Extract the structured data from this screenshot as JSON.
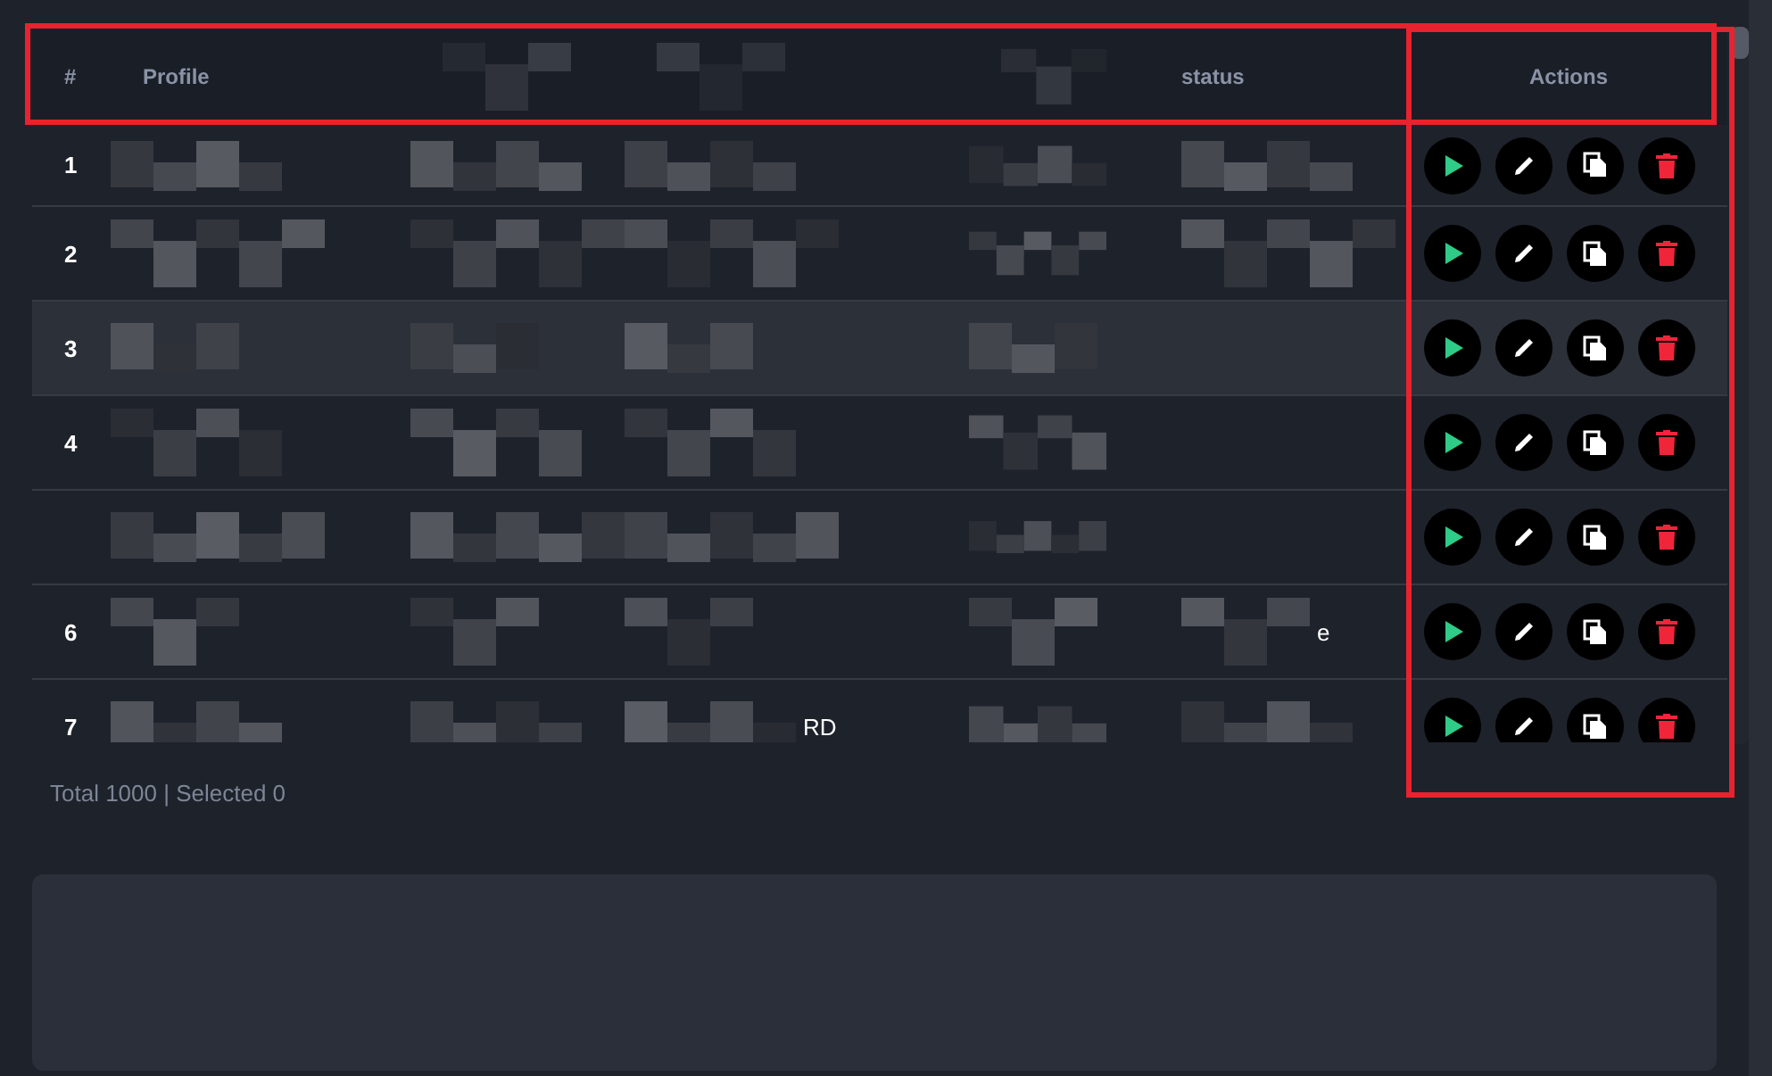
{
  "table": {
    "header_outlined": true,
    "columns": [
      {
        "label": "#",
        "outlined": false
      },
      {
        "label": "Profile",
        "outlined": false
      },
      {
        "redacted": true,
        "outlined": false
      },
      {
        "redacted": true,
        "outlined": false
      },
      {
        "redacted": true,
        "outlined": false
      },
      {
        "label": "status",
        "outlined": false
      },
      {
        "label": "Actions",
        "kind": "actions",
        "outlined": true
      }
    ],
    "rows": [
      {
        "number": "1",
        "highlighted": false,
        "cells": [
          {
            "redacted": true
          },
          {
            "redacted": true
          },
          {
            "redacted": true
          },
          {
            "redacted": true
          },
          {
            "redacted": true
          }
        ]
      },
      {
        "number": "2",
        "highlighted": false,
        "cells": [
          {
            "redacted": true
          },
          {
            "redacted": true
          },
          {
            "redacted": true
          },
          {
            "redacted": true
          },
          {
            "redacted": true
          }
        ]
      },
      {
        "number": "3",
        "highlighted": true,
        "cells": [
          {
            "redacted": true
          },
          {
            "redacted": true
          },
          {
            "redacted": true
          },
          {
            "redacted": true
          },
          {
            "redacted": false
          }
        ]
      },
      {
        "number": "4",
        "highlighted": false,
        "cells": [
          {
            "redacted": true
          },
          {
            "redacted": true
          },
          {
            "redacted": true
          },
          {
            "redacted": true
          },
          {
            "redacted": false
          }
        ]
      },
      {
        "highlighted": false,
        "cells": [
          {
            "redacted": true
          },
          {
            "redacted": true
          },
          {
            "redacted": true
          },
          {
            "redacted": true
          },
          {
            "redacted": false
          }
        ]
      },
      {
        "number": "6",
        "highlighted": false,
        "cells": [
          {
            "redacted": true
          },
          {
            "redacted": true
          },
          {
            "redacted": true
          },
          {
            "redacted": true
          },
          {
            "redacted": true,
            "text": "e"
          }
        ]
      },
      {
        "number": "7",
        "highlighted": false,
        "cells": [
          {
            "redacted": true
          },
          {
            "redacted": true
          },
          {
            "redacted": true,
            "text": "RD"
          },
          {
            "redacted": true
          },
          {
            "redacted": true
          }
        ]
      }
    ],
    "actions": [
      {
        "kind": "play"
      },
      {
        "kind": "edit"
      },
      {
        "kind": "copy"
      },
      {
        "kind": "delete"
      }
    ]
  },
  "footer": "Total 1000 | Selected 0"
}
